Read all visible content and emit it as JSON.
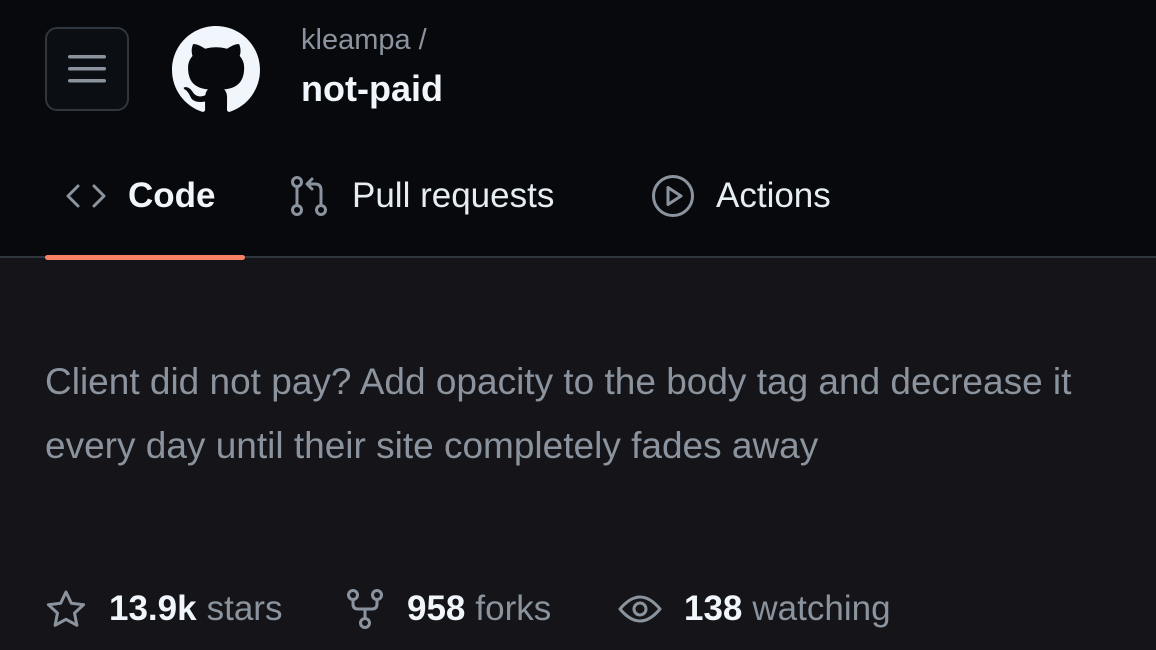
{
  "header": {
    "menu_icon": "hamburger-icon",
    "logo_icon": "github-logo",
    "owner": "kleampa /",
    "repo": "not-paid"
  },
  "tabs": [
    {
      "label": "Code",
      "icon": "code-icon",
      "selected": true
    },
    {
      "label": "Pull requests",
      "icon": "git-pull-request-icon",
      "selected": false
    },
    {
      "label": "Actions",
      "icon": "play-icon",
      "selected": false
    }
  ],
  "description": "Client did not pay? Add opacity to the body tag and decrease it every day until their site completely fades away",
  "stats": {
    "stars": {
      "value": "13.9k",
      "label": "stars",
      "icon": "star-icon"
    },
    "forks": {
      "value": "958",
      "label": "forks",
      "icon": "repo-forked-icon"
    },
    "watching": {
      "value": "138",
      "label": "watching",
      "icon": "eye-icon"
    }
  },
  "colors": {
    "header_bg": "#07090d",
    "page_bg": "#151519",
    "accent_underline": "#f78166",
    "muted_text": "#8b949e",
    "primary_text": "#f0f6fc"
  }
}
